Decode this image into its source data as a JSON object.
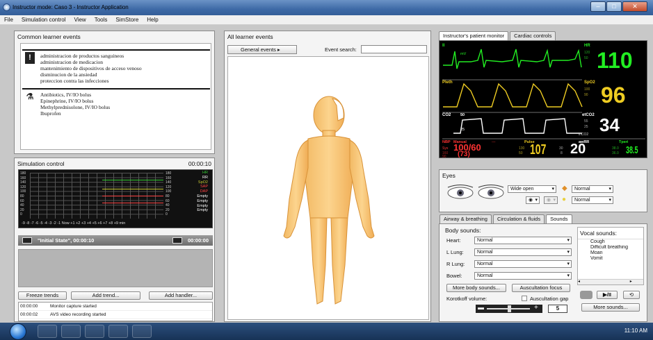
{
  "window": {
    "title": "Instructor mode: Caso 3 - Instructor Application",
    "menu": [
      "File",
      "Simulation control",
      "View",
      "Tools",
      "SimStore",
      "Help"
    ]
  },
  "common_events": {
    "title": "Common learner events",
    "group1": [
      "administracion de productos sanguineos",
      "administracion de medicacion",
      "mantenimiento de dispositivos de acceso venoso",
      "disminucion de la ansiedad",
      "proteccion contra las infecciones"
    ],
    "group2": [
      "Antibiotics, IV/IO bolus",
      "Epinephrine, IV/IO bolus",
      "Methylprednisolone, IV/IO bolus",
      "Ibuprofen"
    ]
  },
  "sim_control": {
    "title": "Simulation control",
    "time": "00:00:10",
    "left_scale": [
      "180",
      "160",
      "140",
      "120",
      "100",
      "80",
      "60",
      "40",
      "20",
      "0"
    ],
    "right_scale": [
      "180",
      "160",
      "140",
      "120",
      "100",
      "80",
      "60",
      "40",
      "20",
      "0"
    ],
    "xaxis": "-9 -8 -7 -6 -5 -4 -3 -2 -1 Now +1 +2 +3 +4 +5 +6 +7 +8 +9  min",
    "legend": [
      {
        "label": "HR",
        "color": "#33cc33"
      },
      {
        "label": "RR",
        "color": "#ffffff"
      },
      {
        "label": "SpO2",
        "color": "#cccc33"
      },
      {
        "label": "SAP",
        "color": "#ff4444"
      },
      {
        "label": "DAP",
        "color": "#ff4444"
      },
      {
        "label": "Empty",
        "color": "#ffffff"
      },
      {
        "label": "Empty",
        "color": "#ffffff"
      },
      {
        "label": "Empty",
        "color": "#ffffff"
      },
      {
        "label": "Empty",
        "color": "#ffffff"
      }
    ],
    "state": "\"Initial State\", 00:00:10",
    "state_time": "00:00:00",
    "freeze_trends": "Freeze trends",
    "add_trend": "Add trend...",
    "add_handler": "Add handler...",
    "log": [
      {
        "time": "00:00:00",
        "text": "Monitor capture started"
      },
      {
        "time": "00:00:02",
        "text": "AVS video recording started"
      }
    ]
  },
  "all_events": {
    "title": "All learner events",
    "general_events": "General events",
    "search_label": "Event search:",
    "search_value": ""
  },
  "monitor_tabs": {
    "tab1": "Instructor's patient monitor",
    "tab2": "Cardiac controls"
  },
  "monitor": {
    "ii": "II",
    "mv": "mV",
    "pleth": "Pleth",
    "co2": "CO2",
    "co2_scale": "50",
    "co2_25": "25",
    "hr_label": "HR",
    "hr_hi": "120",
    "hr_lo": "50",
    "hr_value": "110",
    "spo2_label": "SpO2",
    "spo2_hi": "100",
    "spo2_lo": "90",
    "spo2_value": "96",
    "etco2_label": "etCO2",
    "etco2_hi": "55",
    "etco2_lo": "25",
    "etco2_value": "34",
    "inco2": "inCO2",
    "nbp_label": "NBP",
    "nbp_mode": "Manual",
    "nbp_dashes": "---",
    "sys": "Sys",
    "sys_hi": "160",
    "sys_lo": "90",
    "nbp_value": "100/60",
    "nbp_mean": "(73)",
    "pulse_label": "Pulse",
    "pulse_hi": "130",
    "pulse_lo": "50",
    "pulse_value": "107",
    "awrr_label": "awRR",
    "awrr_hi": "30",
    "awrr_lo": "8",
    "awrr_value": "20",
    "tperi_label": "Tperi",
    "tperi_hi": "38.0",
    "tperi_lo": "36.0",
    "tperi_value": "38.5"
  },
  "eyes": {
    "title": "Eyes",
    "state": "Wide open",
    "pupil1": "Normal",
    "pupil2": "Normal"
  },
  "sound_tabs": {
    "tab1": "Airway & breathing",
    "tab2": "Circulation & fluids",
    "tab3": "Sounds"
  },
  "sounds": {
    "body_title": "Body sounds:",
    "heart_label": "Heart:",
    "heart": "Normal",
    "llung_label": "L Lung:",
    "llung": "Normal",
    "rlung_label": "R Lung:",
    "rlung": "Normal",
    "bowel_label": "Bowel:",
    "bowel": "Normal",
    "more_body": "More body sounds...",
    "ausc_focus": "Auscultation focus",
    "korotkoff": "Korotkoff volume:",
    "ausc_gap": "Auscultation gap",
    "volume": "5",
    "vocal_title": "Vocal sounds:",
    "vocal": [
      "Cough",
      "Difficult breathing",
      "Moan",
      "Vomit"
    ],
    "more_sounds": "More sounds...",
    "play": "▶/II"
  },
  "tray": {
    "time": "11:10 AM"
  }
}
